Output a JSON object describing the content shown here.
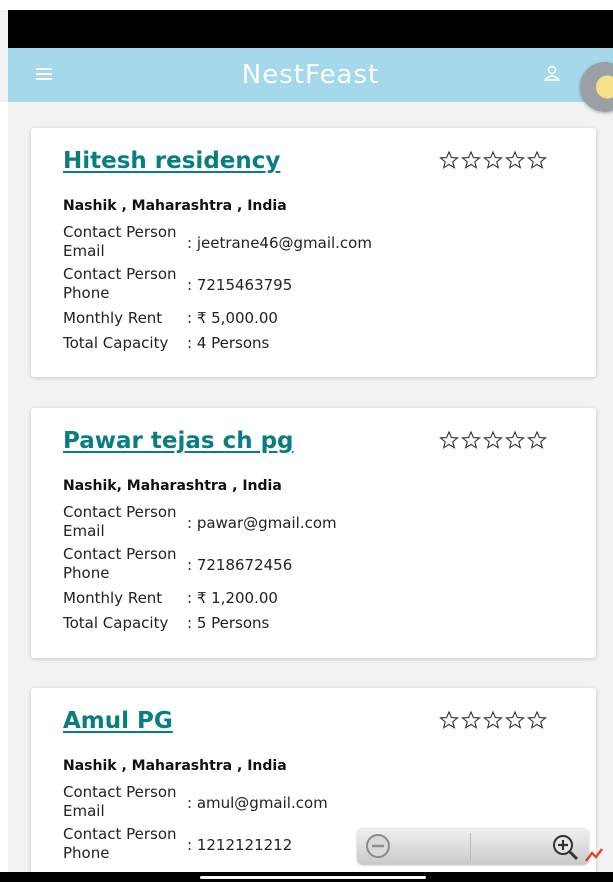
{
  "app": {
    "title": "NestFeast",
    "accent_color": "#a4d8ea",
    "title_color": "#0a7d80"
  },
  "icons": {
    "menu": "hamburger-menu-icon",
    "user": "user-profile-icon",
    "star": "star-outline-icon",
    "zoom_out": "zoom-out-icon",
    "zoom_in": "zoom-in-icon"
  },
  "labels": {
    "email": "Contact Person Email",
    "phone": "Contact Person Phone",
    "rent": "Monthly Rent",
    "capacity": "Total Capacity",
    "colon": ":"
  },
  "listings": [
    {
      "name": "Hitesh residency",
      "address": "Nashik , Maharashtra , India",
      "email": ": jeetrane46@gmail.com",
      "phone": ": 7215463795",
      "rent": ": ₹ 5,000.00",
      "capacity": ": 4 Persons",
      "rating": 0
    },
    {
      "name": "Pawar tejas ch pg",
      "address": "Nashik, Maharashtra , India",
      "email": ": pawar@gmail.com",
      "phone": ": 7218672456",
      "rent": ": ₹ 1,200.00",
      "capacity": ": 5 Persons",
      "rating": 0
    },
    {
      "name": "Amul PG",
      "address": "Nashik , Maharashtra , India",
      "email": ": amul@gmail.com",
      "phone": ": 1212121212",
      "rating": 0
    }
  ]
}
